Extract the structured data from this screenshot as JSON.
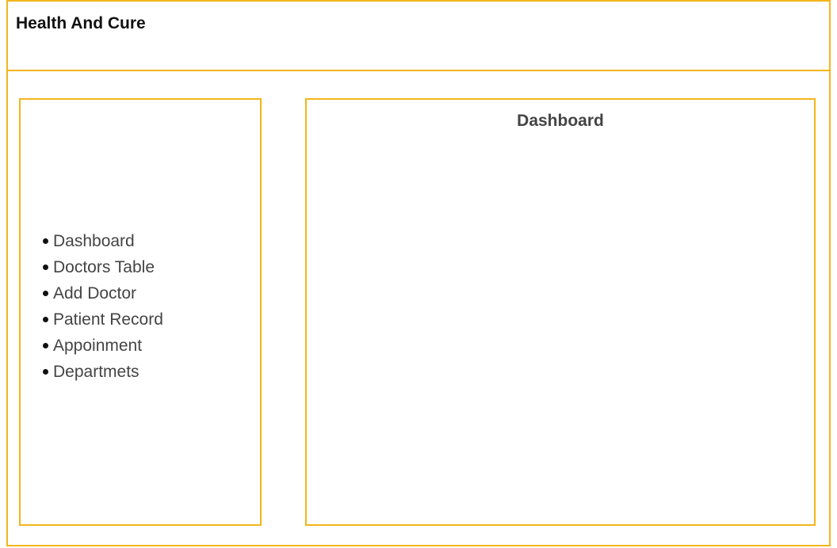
{
  "header": {
    "title": "Health And Cure"
  },
  "sidebar": {
    "items": [
      {
        "label": "Dashboard",
        "icon": "bullet"
      },
      {
        "label": "Doctors Table",
        "icon": "bullet"
      },
      {
        "label": "Add Doctor",
        "icon": "bullet"
      },
      {
        "label": "Patient Record",
        "icon": "bullet"
      },
      {
        "label": "Appoinment",
        "icon": "bullet"
      },
      {
        "label": "Departmets",
        "icon": "bullet"
      }
    ]
  },
  "main": {
    "title": "Dashboard"
  },
  "colors": {
    "border_accent": "#f3b51a",
    "text_dark": "#111111",
    "text_muted": "#444444"
  }
}
